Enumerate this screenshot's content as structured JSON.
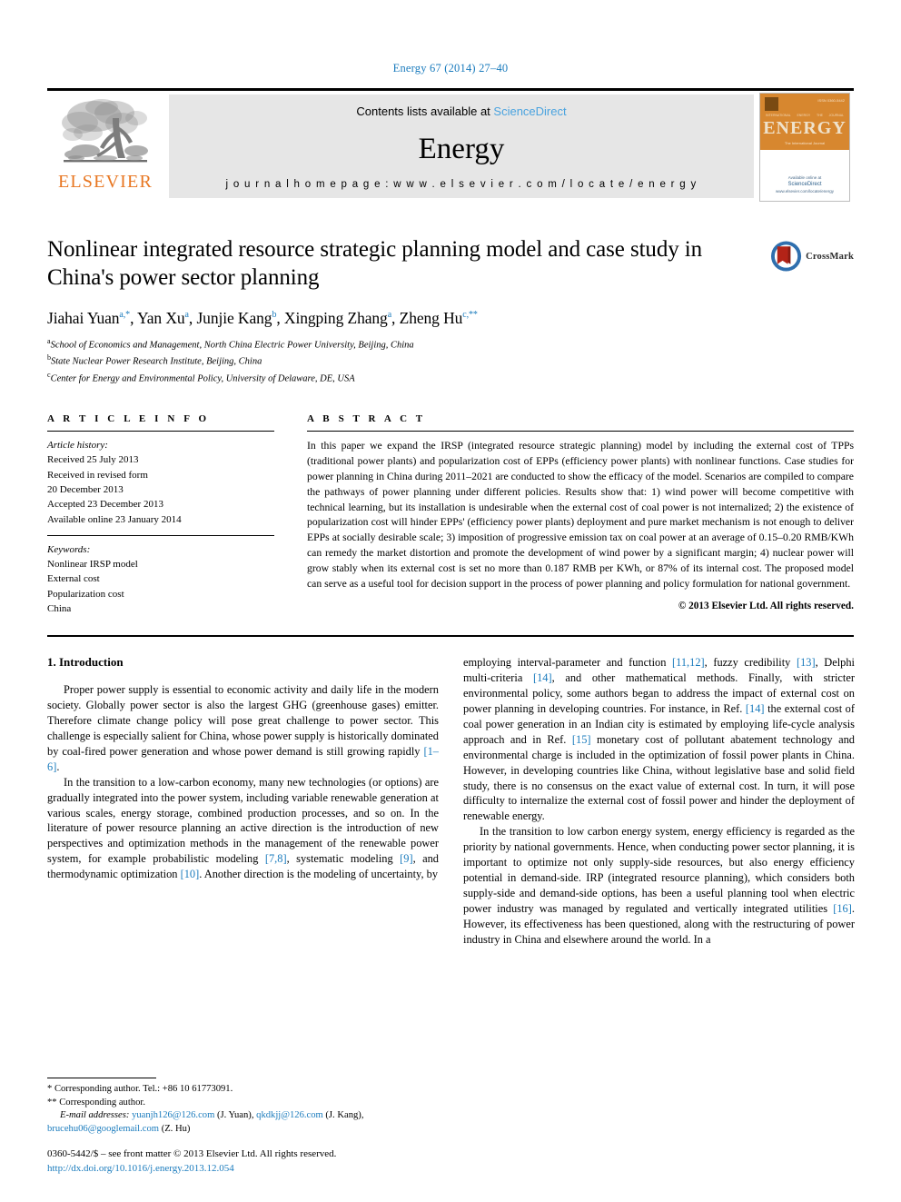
{
  "running_head": "Energy 67 (2014) 27–40",
  "masthead": {
    "publisher_word": "ELSEVIER",
    "contents_prefix": "Contents lists available at ",
    "sciencedirect": "ScienceDirect",
    "journal_name": "Energy",
    "homepage": "j o u r n a l   h o m e p a g e :   w w w . e l s e v i e r . c o m / l o c a t e / e n e r g y",
    "cover": {
      "title": "ENERGY",
      "issue": "ISSN 0360-5442",
      "bands": [
        "INTERNATIONAL",
        "ENERGY",
        "THE",
        "JOURNAL"
      ],
      "subtitle": "The International Journal",
      "foot_small": "Available online at",
      "foot_big": "ScienceDirect",
      "foot_url": "www.elsevier.com/locate/energy"
    }
  },
  "article": {
    "title": "Nonlinear integrated resource strategic planning model and case study in China's power sector planning",
    "crossmark_label": "CrossMark",
    "authors": [
      {
        "name": "Jiahai Yuan",
        "marks": "a,*"
      },
      {
        "name": "Yan Xu",
        "marks": "a"
      },
      {
        "name": "Junjie Kang",
        "marks": "b"
      },
      {
        "name": "Xingping Zhang",
        "marks": "a"
      },
      {
        "name": "Zheng Hu",
        "marks": "c,**"
      }
    ],
    "affiliations": [
      {
        "mark": "a",
        "text": "School of Economics and Management, North China Electric Power University, Beijing, China"
      },
      {
        "mark": "b",
        "text": "State Nuclear Power Research Institute, Beijing, China"
      },
      {
        "mark": "c",
        "text": "Center for Energy and Environmental Policy, University of Delaware, DE, USA"
      }
    ]
  },
  "article_info": {
    "heading": "A R T I C L E   I N F O",
    "history_label": "Article history:",
    "history": [
      "Received 25 July 2013",
      "Received in revised form",
      "20 December 2013",
      "Accepted 23 December 2013",
      "Available online 23 January 2014"
    ],
    "keywords_label": "Keywords:",
    "keywords": [
      "Nonlinear IRSP model",
      "External cost",
      "Popularization cost",
      "China"
    ]
  },
  "abstract": {
    "heading": "A B S T R A C T",
    "text": "In this paper we expand the IRSP (integrated resource strategic planning) model by including the external cost of TPPs (traditional power plants) and popularization cost of EPPs (efficiency power plants) with nonlinear functions. Case studies for power planning in China during 2011–2021 are conducted to show the efficacy of the model. Scenarios are compiled to compare the pathways of power planning under different policies. Results show that: 1) wind power will become competitive with technical learning, but its installation is undesirable when the external cost of coal power is not internalized; 2) the existence of popularization cost will hinder EPPs' (efficiency power plants) deployment and pure market mechanism is not enough to deliver EPPs at socially desirable scale; 3) imposition of progressive emission tax on coal power at an average of 0.15–0.20 RMB/KWh can remedy the market distortion and promote the development of wind power by a significant margin; 4) nuclear power will grow stably when its external cost is set no more than 0.187 RMB per KWh, or 87% of its internal cost. The proposed model can serve as a useful tool for decision support in the process of power planning and policy formulation for national government.",
    "copyright": "© 2013 Elsevier Ltd. All rights reserved."
  },
  "introduction": {
    "heading": "1. Introduction",
    "left_paragraphs": [
      "Proper power supply is essential to economic activity and daily life in the modern society. Globally power sector is also the largest GHG (greenhouse gases) emitter. Therefore climate change policy will pose great challenge to power sector. This challenge is especially salient for China, whose power supply is historically dominated by coal-fired power generation and whose power demand is still growing rapidly [1–6].",
      "In the transition to a low-carbon economy, many new technologies (or options) are gradually integrated into the power system, including variable renewable generation at various scales, energy storage, combined production processes, and so on. In the literature of power resource planning an active direction is the introduction of new perspectives and optimization methods in the management of the renewable power system, for example probabilistic modeling [7,8], systematic modeling [9], and thermodynamic optimization [10]. Another direction is the modeling of uncertainty, by"
    ],
    "right_paragraphs": [
      "employing interval-parameter and function [11,12], fuzzy credibility [13], Delphi multi-criteria [14], and other mathematical methods. Finally, with stricter environmental policy, some authors began to address the impact of external cost on power planning in developing countries. For instance, in Ref. [14] the external cost of coal power generation in an Indian city is estimated by employing life-cycle analysis approach and in Ref. [15] monetary cost of pollutant abatement technology and environmental charge is included in the optimization of fossil power plants in China. However, in developing countries like China, without legislative base and solid field study, there is no consensus on the exact value of external cost. In turn, it will pose difficulty to internalize the external cost of fossil power and hinder the deployment of renewable energy.",
      "In the transition to low carbon energy system, energy efficiency is regarded as the priority by national governments. Hence, when conducting power sector planning, it is important to optimize not only supply-side resources, but also energy efficiency potential in demand-side. IRP (integrated resource planning), which considers both supply-side and demand-side options, has been a useful planning tool when electric power industry was managed by regulated and vertically integrated utilities [16]. However, its effectiveness has been questioned, along with the restructuring of power industry in China and elsewhere around the world. In a"
    ]
  },
  "footnotes": {
    "corresponding_1": "* Corresponding author. Tel.: +86 10 61773091.",
    "corresponding_2": "** Corresponding author.",
    "email_label": "E-mail addresses:",
    "emails": [
      {
        "address": "yuanjh126@126.com",
        "owner": "(J. Yuan)"
      },
      {
        "address": "qkdkjj@126.com",
        "owner": "(J. Kang)"
      },
      {
        "address": "brucehu06@googlemail.com",
        "owner": "(Z. Hu)"
      }
    ],
    "front_matter": "0360-5442/$ – see front matter © 2013 Elsevier Ltd. All rights reserved.",
    "doi": "http://dx.doi.org/10.1016/j.energy.2013.12.054"
  },
  "colors": {
    "link_blue": "#1a7bbd",
    "sciencedirect_blue": "#4aa3df",
    "elsevier_orange": "#e87722",
    "cover_orange": "#d7872f"
  }
}
